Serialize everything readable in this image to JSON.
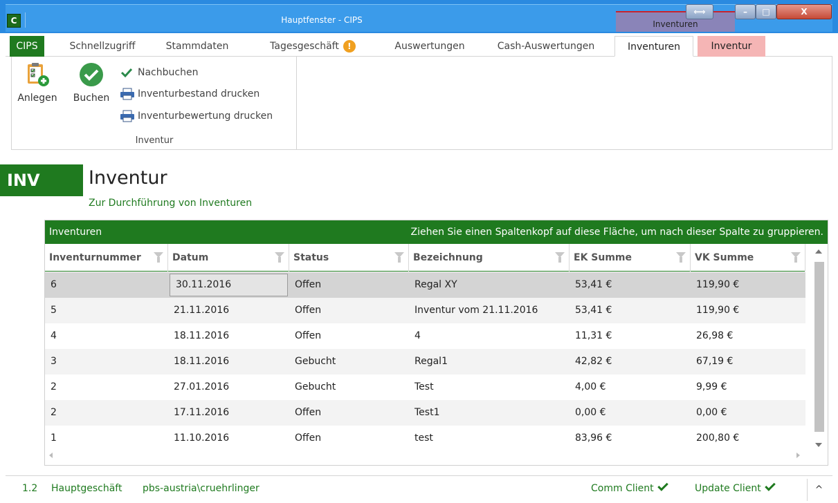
{
  "window": {
    "title": "Hauptfenster - CIPS",
    "app_icon": "C",
    "context_header": "Inventuren",
    "controls": {
      "resize": "⟺",
      "minimize": "–",
      "maximize": "□",
      "close": "X"
    }
  },
  "menu": {
    "tabs": [
      {
        "label": "CIPS"
      },
      {
        "label": "Schnellzugriff"
      },
      {
        "label": "Stammdaten"
      },
      {
        "label": "Tagesgeschäft"
      },
      {
        "label": "Auswertungen"
      },
      {
        "label": "Cash-Auswertungen"
      },
      {
        "label": "Inventuren"
      },
      {
        "label": "Inventur"
      }
    ],
    "warning_badge": "!"
  },
  "ribbon": {
    "group_label": "Inventur",
    "anlegen": "Anlegen",
    "buchen": "Buchen",
    "nachbuchen": "Nachbuchen",
    "bestand_drucken": "Inventurbestand drucken",
    "bewertung_drucken": "Inventurbewertung drucken"
  },
  "page": {
    "badge": "INV",
    "title": "Inventur",
    "subtitle": "Zur Durchführung von Inventuren"
  },
  "grid": {
    "title": "Inventuren",
    "group_hint": "Ziehen Sie einen Spaltenkopf auf diese Fläche, um nach dieser Spalte zu gruppieren.",
    "columns": [
      "Inventurnummer",
      "Datum",
      "Status",
      "Bezeichnung",
      "EK Summe",
      "VK Summe"
    ],
    "rows": [
      {
        "nr": "6",
        "datum": "30.11.2016",
        "status": "Offen",
        "bez": "Regal XY",
        "ek": "53,41 €",
        "vk": "119,90 €"
      },
      {
        "nr": "5",
        "datum": "21.11.2016",
        "status": "Offen",
        "bez": "Inventur vom 21.11.2016",
        "ek": "53,41 €",
        "vk": "119,90 €"
      },
      {
        "nr": "4",
        "datum": "18.11.2016",
        "status": "Offen",
        "bez": "4",
        "ek": "11,31 €",
        "vk": "26,98 €"
      },
      {
        "nr": "3",
        "datum": "18.11.2016",
        "status": "Gebucht",
        "bez": "Regal1",
        "ek": "42,82 €",
        "vk": "67,19 €"
      },
      {
        "nr": "2",
        "datum": "27.01.2016",
        "status": "Gebucht",
        "bez": "Test",
        "ek": "4,00 €",
        "vk": "9,99 €"
      },
      {
        "nr": "2",
        "datum": "17.11.2016",
        "status": "Offen",
        "bez": "Test1",
        "ek": "0,00 €",
        "vk": "0,00 €"
      },
      {
        "nr": "1",
        "datum": "11.10.2016",
        "status": "Offen",
        "bez": "test",
        "ek": "83,96 €",
        "vk": "200,80 €"
      }
    ]
  },
  "status": {
    "version": "1.2",
    "company": "Hauptgeschäft",
    "user": "pbs-austria\\cruehrlinger",
    "comm_client": "Comm Client",
    "update_client": "Update Client",
    "collapse": "^"
  },
  "colors": {
    "accent_green": "#1f7a1f",
    "context_tab": "#f5b5b5",
    "titlebar": "#3b9bea"
  }
}
